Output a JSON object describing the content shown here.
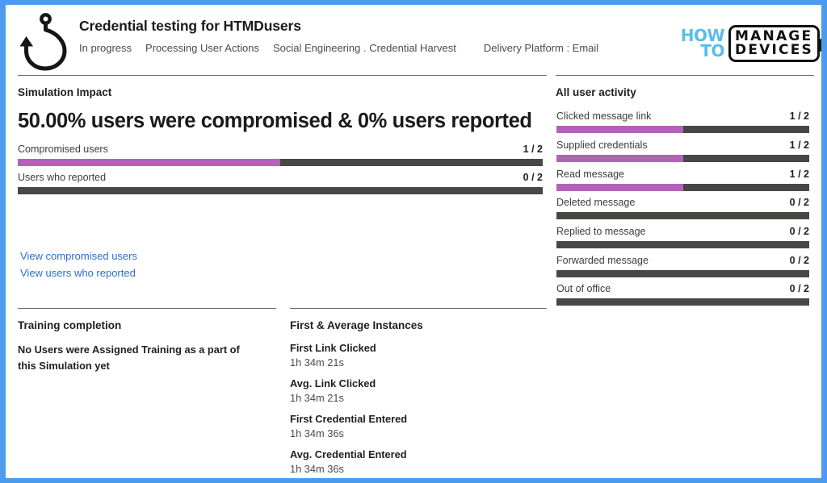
{
  "header": {
    "icon": "fishing-hook-icon",
    "title": "Credential testing for HTMDusers",
    "status": "In progress",
    "stage": "Processing User Actions",
    "technique": "Social Engineering . Credential Harvest",
    "delivery": "Delivery Platform : Email"
  },
  "logo": {
    "line1": "HOW",
    "line2": "TO",
    "word1": "MANAGE",
    "word2": "DEVICES",
    "accent_color": "#5bbcea",
    "ink_color": "#111111"
  },
  "simulation_impact": {
    "heading": "Simulation Impact",
    "headline": "50.00% users were compromised & 0% users reported",
    "bars": [
      {
        "label": "Compromised users",
        "value": "1 / 2",
        "percent": 50
      },
      {
        "label": "Users who reported",
        "value": "0 / 2",
        "percent": 0
      }
    ],
    "links": [
      {
        "label": "View compromised users"
      },
      {
        "label": "View users who reported"
      }
    ]
  },
  "all_user_activity": {
    "heading": "All user activity",
    "bars": [
      {
        "label": "Clicked message link",
        "value": "1 / 2",
        "percent": 50
      },
      {
        "label": "Supplied credentials",
        "value": "1 / 2",
        "percent": 50
      },
      {
        "label": "Read message",
        "value": "1 / 2",
        "percent": 50
      },
      {
        "label": "Deleted message",
        "value": "0 / 2",
        "percent": 0
      },
      {
        "label": "Replied to message",
        "value": "0 / 2",
        "percent": 0
      },
      {
        "label": "Forwarded message",
        "value": "0 / 2",
        "percent": 0
      },
      {
        "label": "Out of office",
        "value": "0 / 2",
        "percent": 0
      }
    ]
  },
  "training_completion": {
    "heading": "Training completion",
    "message": "No Users were Assigned Training as a part of this Simulation yet"
  },
  "instances": {
    "heading": "First & Average Instances",
    "items": [
      {
        "name": "First Link Clicked",
        "value": "1h 34m 21s"
      },
      {
        "name": "Avg. Link Clicked",
        "value": "1h 34m 21s"
      },
      {
        "name": "First Credential Entered",
        "value": "1h 34m 36s"
      },
      {
        "name": "Avg. Credential Entered",
        "value": "1h 34m 36s"
      }
    ]
  },
  "colors": {
    "frame": "#4c9bef",
    "bar_fill": "#b263b8",
    "bar_track": "#474745",
    "link": "#2a6fce"
  },
  "chart_data": {
    "type": "bar",
    "title": "Simulation Impact and All user activity",
    "orientation": "horizontal",
    "ylim": [
      0,
      2
    ],
    "series": [
      {
        "name": "Simulation Impact",
        "categories": [
          "Compromised users",
          "Users who reported"
        ],
        "values": [
          1,
          0
        ],
        "totals": [
          2,
          2
        ],
        "percents": [
          50,
          0
        ],
        "labels": [
          "1 / 2",
          "0 / 2"
        ]
      },
      {
        "name": "All user activity",
        "categories": [
          "Clicked message link",
          "Supplied credentials",
          "Read message",
          "Deleted message",
          "Replied to message",
          "Forwarded message",
          "Out of office"
        ],
        "values": [
          1,
          1,
          1,
          0,
          0,
          0,
          0
        ],
        "totals": [
          2,
          2,
          2,
          2,
          2,
          2,
          2
        ],
        "percents": [
          50,
          50,
          50,
          0,
          0,
          0,
          0
        ],
        "labels": [
          "1 / 2",
          "1 / 2",
          "1 / 2",
          "0 / 2",
          "0 / 2",
          "0 / 2",
          "0 / 2"
        ]
      }
    ],
    "grid": false,
    "legend": "none"
  }
}
